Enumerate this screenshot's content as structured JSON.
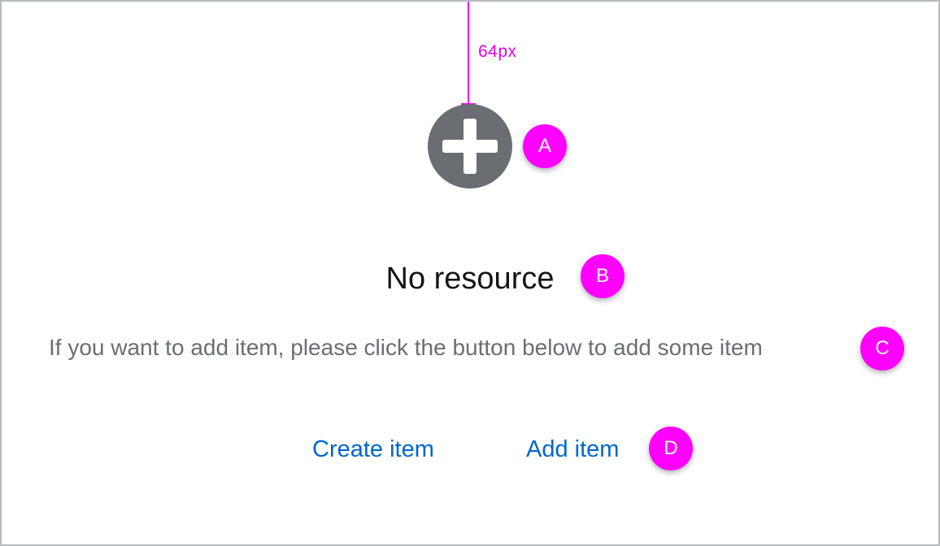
{
  "spacing_annotation": {
    "label": "64px",
    "color": "#ff00ff"
  },
  "empty_state": {
    "icon": "plus-circle-icon",
    "title": "No resource",
    "body": "If you want to add item, please click the button below to add some item",
    "actions": [
      {
        "label": "Create item"
      },
      {
        "label": "Add item"
      }
    ]
  },
  "callouts": [
    "A",
    "B",
    "C",
    "D"
  ],
  "colors": {
    "icon": "#6a6e73",
    "title": "#151515",
    "body": "#6a6e73",
    "link": "#0066cc",
    "annotation": "#ff00ff",
    "border": "#b8bbbe"
  }
}
